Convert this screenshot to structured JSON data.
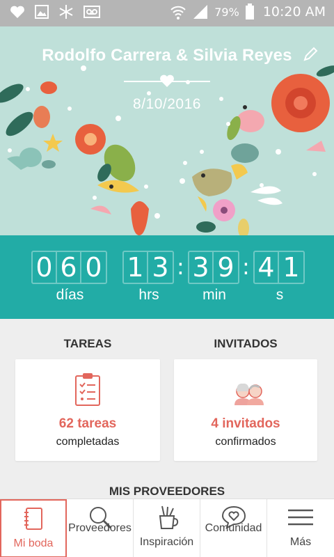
{
  "status_bar": {
    "battery_percent": "79%",
    "time": "10:20 AM",
    "icons": [
      "heart-icon",
      "image-icon",
      "snowflake-icon",
      "voicemail-icon",
      "wifi-icon",
      "signal-icon",
      "battery-icon"
    ]
  },
  "hero": {
    "couple_names": "Rodolfo Carrera & Silvia Reyes",
    "date": "8/10/2016",
    "background_color": "#bfe0d9"
  },
  "countdown": {
    "days_digits": [
      "0",
      "6",
      "0"
    ],
    "hours_digits": [
      "1",
      "3"
    ],
    "minutes_digits": [
      "3",
      "9"
    ],
    "seconds_digits": [
      "4",
      "1"
    ],
    "separator": ":",
    "labels": {
      "days": "días",
      "hours": "hrs",
      "minutes": "min",
      "seconds": "s"
    },
    "color": "#22aca6"
  },
  "sections": {
    "tasks": {
      "title": "TAREAS",
      "count_text": "62 tareas",
      "sub_text": "completadas"
    },
    "guests": {
      "title": "INVITADOS",
      "count_text": "4 invitados",
      "sub_text": "confirmados"
    },
    "vendors": {
      "title": "MIS PROVEEDORES"
    }
  },
  "bottom_nav": {
    "items": [
      {
        "label": "Mi boda",
        "icon": "notebook-icon",
        "active": true
      },
      {
        "label": "Proveedores",
        "icon": "search-icon",
        "active": false
      },
      {
        "label": "Inspiración",
        "icon": "pencil-cup-icon",
        "active": false
      },
      {
        "label": "Comunidad",
        "icon": "heart-chat-icon",
        "active": false
      },
      {
        "label": "Más",
        "icon": "menu-icon",
        "active": false
      }
    ]
  },
  "accent_color": "#e2665c"
}
